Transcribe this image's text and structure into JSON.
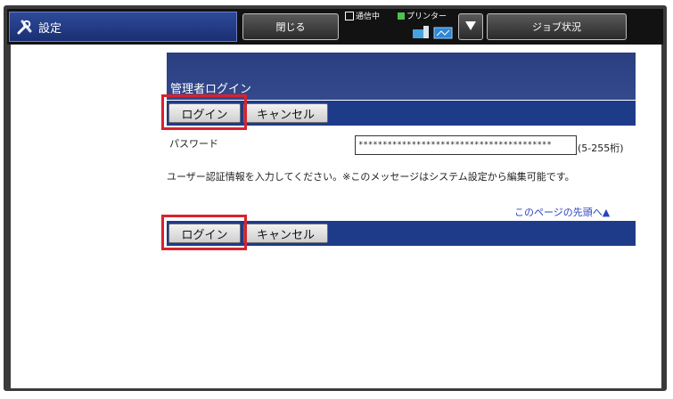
{
  "topbar": {
    "title": "設定",
    "close_label": "閉じる",
    "status_comm": "通信中",
    "status_printer": "プリンター",
    "job_status_label": "ジョブ状況"
  },
  "login": {
    "header_title": "管理者ログイン",
    "login_label": "ログイン",
    "cancel_label": "キャンセル",
    "password_label": "パスワード",
    "password_value": "****************************************",
    "password_hint": "(5-255桁)",
    "message": "ユーザー認証情報を入力してください。※このメッセージはシステム設定から編集可能です。",
    "page_top_link": "このページの先頭へ▲"
  },
  "colors": {
    "highlight": "#d8222f",
    "bar": "#1e3b8a",
    "header": "#2a3f80"
  }
}
